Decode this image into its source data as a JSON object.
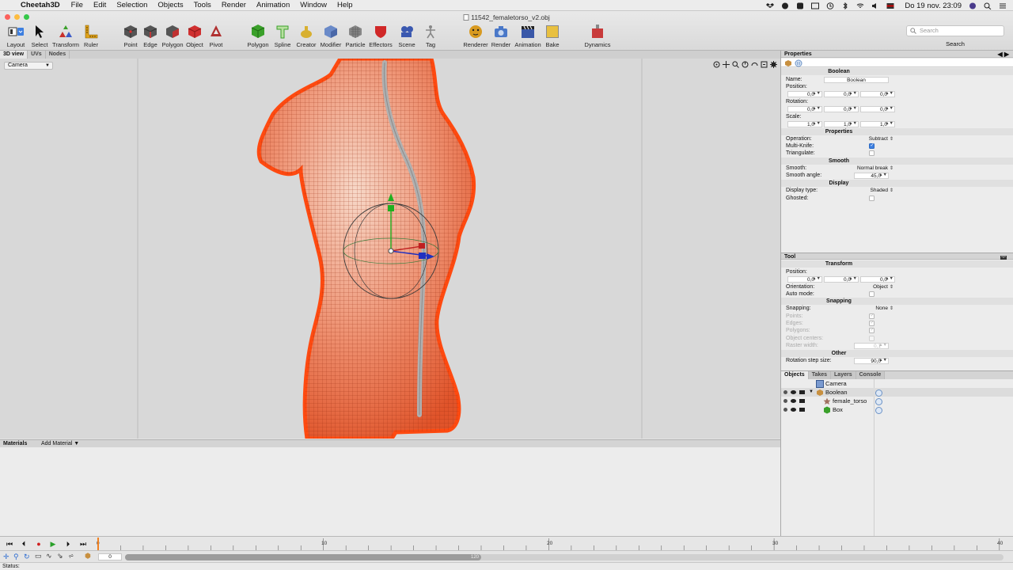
{
  "menubar": {
    "app_name": "Cheetah3D",
    "items": [
      "File",
      "Edit",
      "Selection",
      "Objects",
      "Tools",
      "Render",
      "Animation",
      "Window",
      "Help"
    ],
    "clock": "Do 19 nov.  23:09"
  },
  "window": {
    "title": "11542_femaletorso_v2.obj"
  },
  "toolbar": {
    "tools": [
      {
        "label": "Layout",
        "icon": "layout-icon"
      },
      {
        "label": "Select",
        "icon": "arrow-icon"
      },
      {
        "label": "Transform",
        "icon": "transform-icon"
      },
      {
        "label": "Ruler",
        "icon": "ruler-icon"
      },
      {
        "label": "Point",
        "icon": "point-cube-icon"
      },
      {
        "label": "Edge",
        "icon": "edge-cube-icon"
      },
      {
        "label": "Polygon",
        "icon": "polygon-cube-icon"
      },
      {
        "label": "Object",
        "icon": "object-cube-icon"
      },
      {
        "label": "Pivot",
        "icon": "pivot-icon"
      },
      {
        "label": "Polygon",
        "icon": "polygon-create-icon"
      },
      {
        "label": "Spline",
        "icon": "spline-icon"
      },
      {
        "label": "Creator",
        "icon": "creator-icon"
      },
      {
        "label": "Modifier",
        "icon": "modifier-icon"
      },
      {
        "label": "Particle",
        "icon": "particle-icon"
      },
      {
        "label": "Effectors",
        "icon": "effectors-icon"
      },
      {
        "label": "Scene",
        "icon": "scene-icon"
      },
      {
        "label": "Tag",
        "icon": "tag-icon"
      },
      {
        "label": "Renderer",
        "icon": "renderer-icon"
      },
      {
        "label": "Render",
        "icon": "camera-icon"
      },
      {
        "label": "Animation",
        "icon": "clapper-icon"
      },
      {
        "label": "Bake",
        "icon": "bake-icon"
      },
      {
        "label": "Dynamics",
        "icon": "dynamics-icon"
      }
    ],
    "search_placeholder": "Search",
    "search_label": "Search"
  },
  "viewport": {
    "tabs": [
      "3D view",
      "UVs",
      "Nodes"
    ],
    "active_tab": "3D view",
    "camera_select": "Camera"
  },
  "materials": {
    "title": "Materials",
    "add_label": "Add Material ▼"
  },
  "properties": {
    "header": "Properties",
    "object_title": "Boolean",
    "name_label": "Name:",
    "name_value": "Boolean",
    "position_label": "Position:",
    "position": [
      "0,0",
      "0,0",
      "0,0"
    ],
    "rotation_label": "Rotation:",
    "rotation": [
      "0,0",
      "0,0",
      "0,0"
    ],
    "scale_label": "Scale:",
    "scale": [
      "1,0",
      "1,0",
      "1,0"
    ],
    "sections": {
      "properties": "Properties",
      "smooth": "Smooth",
      "display": "Display"
    },
    "operation_label": "Operation:",
    "operation_value": "Subtract",
    "multiknife_label": "Multi-Knife:",
    "triangulate_label": "Triangulate:",
    "smooth_label": "Smooth:",
    "smooth_value": "Normal break",
    "smooth_angle_label": "Smooth angle:",
    "smooth_angle": "45,0",
    "display_type_label": "Display type:",
    "display_type": "Shaded",
    "ghosted_label": "Ghosted:"
  },
  "tool": {
    "header": "Tool",
    "transform_title": "Transform",
    "position_label": "Position:",
    "position": [
      "0,0",
      "0,0",
      "0,0"
    ],
    "orientation_label": "Orientation:",
    "orientation_value": "Object",
    "auto_mode_label": "Auto mode:",
    "snapping_title": "Snapping",
    "snapping_label": "Snapping:",
    "snapping_value": "None",
    "points_label": "Points:",
    "edges_label": "Edges:",
    "polygons_label": "Polygons:",
    "object_centers_label": "Object centers:",
    "raster_width_label": "Raster width:",
    "raster_width": "0,1",
    "other_title": "Other",
    "rotation_step_label": "Rotation step size:",
    "rotation_step": "90,0"
  },
  "objects": {
    "tabs": [
      "Objects",
      "Takes",
      "Layers",
      "Console"
    ],
    "active_tab": "Objects",
    "items": [
      {
        "name": "Camera",
        "depth": 0
      },
      {
        "name": "Boolean",
        "depth": 0,
        "expanded": true
      },
      {
        "name": "female_torso",
        "depth": 1
      },
      {
        "name": "Box",
        "depth": 1
      }
    ]
  },
  "timeline": {
    "ruler_labels": [
      "0",
      "10",
      "20",
      "30",
      "40"
    ],
    "frame_value": "0",
    "range_end": "120"
  },
  "status": {
    "text": "Status:"
  },
  "colors": {
    "mesh": "#ff4a10",
    "accent": "#3d7fe0"
  }
}
